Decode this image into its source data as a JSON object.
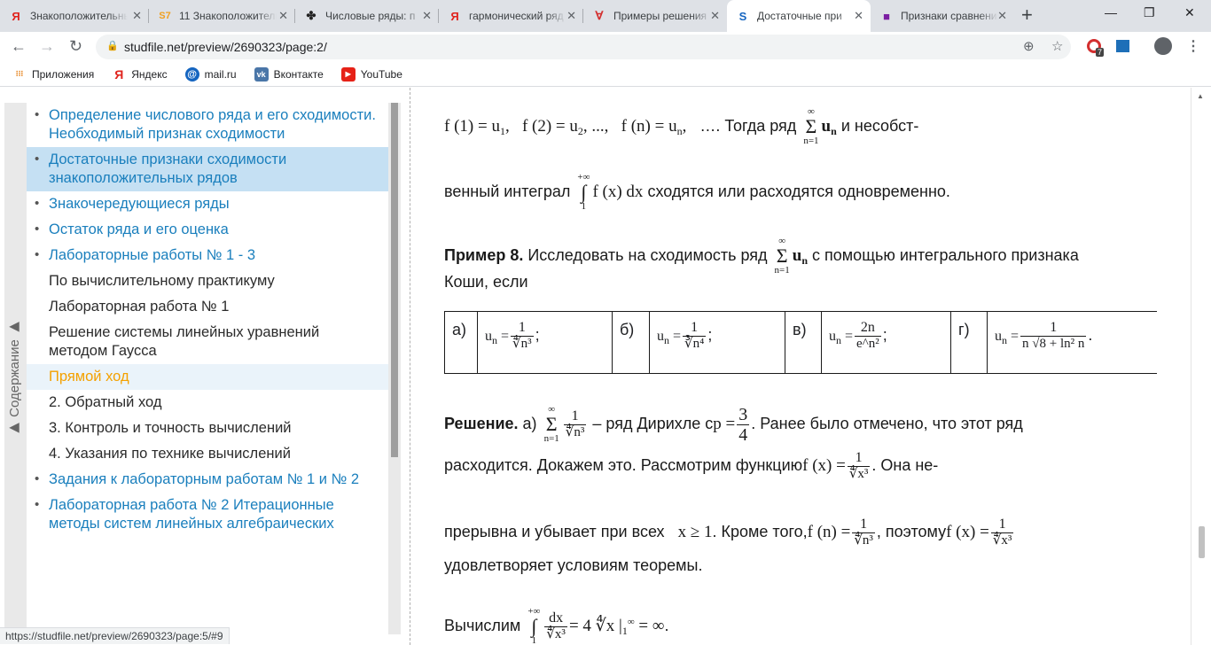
{
  "browser": {
    "tabs": [
      {
        "icon": "Я",
        "title": "Знакоположительные"
      },
      {
        "icon": "S7",
        "title": "11 Знакоположительные"
      },
      {
        "icon": "✤",
        "title": "Числовые ряды: п"
      },
      {
        "icon": "Я",
        "title": "гармонический ряд"
      },
      {
        "icon": "∀",
        "title": "Примеры решения"
      },
      {
        "icon": "S",
        "title": "Достаточные при"
      },
      {
        "icon": "■",
        "title": "Признаки сравнения"
      }
    ],
    "url": "studfile.net/preview/2690323/page:2/",
    "extension_badge": "7",
    "bookmarks": [
      {
        "icon": "⁝⁝⁝",
        "label": "Приложения"
      },
      {
        "icon": "Я",
        "label": "Яндекс"
      },
      {
        "icon": "@",
        "label": "mail.ru"
      },
      {
        "icon": "vk",
        "label": "Вконтакте"
      },
      {
        "icon": "▶",
        "label": "YouTube"
      }
    ],
    "status_url": "https://studfile.net/preview/2690323/page:5/#9"
  },
  "sidebar": {
    "tab_label": "▶ Содержание ▶",
    "items": [
      {
        "label": "Определение числового ряда и его сходимости. Необходимый признак сходимости",
        "dot": true,
        "state": "link"
      },
      {
        "label": "Достаточные признаки сходимости знакоположительных рядов",
        "dot": true,
        "state": "selected"
      },
      {
        "label": "Знакочередующиеся ряды",
        "dot": true,
        "state": "link"
      },
      {
        "label": "Остаток ряда и его оценка",
        "dot": true,
        "state": "link"
      },
      {
        "label": "Лабораторные работы № 1 - 3",
        "dot": true,
        "state": "link"
      },
      {
        "label": "По вычислительному практикуму",
        "dot": false,
        "state": "plain"
      },
      {
        "label": "Лабораторная работа № 1",
        "dot": false,
        "state": "plain"
      },
      {
        "label": "Решение системы линейных уравнений методом Гаусса",
        "dot": false,
        "state": "plain"
      },
      {
        "label": "Прямой ход",
        "dot": false,
        "state": "highlight"
      },
      {
        "label": "2. Обратный ход",
        "dot": false,
        "state": "plain"
      },
      {
        "label": "3. Контроль и точность вычислений",
        "dot": false,
        "state": "plain"
      },
      {
        "label": "4. Указания по технике вычислений",
        "dot": false,
        "state": "plain"
      },
      {
        "label": "Задания к лабораторным работам № 1 и № 2",
        "dot": true,
        "state": "link"
      },
      {
        "label": "Лабораторная работа № 2 Итерационные методы систем линейных алгебраических",
        "dot": true,
        "state": "link"
      }
    ]
  },
  "doc": {
    "l1_mid": "…. Тогда ряд",
    "l1_end": "и несобст-",
    "l2_start": "венный интеграл",
    "l2_end": "сходятся или расходятся одновременно.",
    "ex_title": "Пример 8.",
    "ex_text": "Исследовать на сходимость ряд",
    "ex_text2": "с помощью интегрального признака",
    "ex_text3": "Коши, если",
    "table": [
      {
        "label": "а)",
        "num": "1",
        "den": "∜n³"
      },
      {
        "label": "б)",
        "num": "1",
        "den": "∛n⁴"
      },
      {
        "label": "в)",
        "num": "2n",
        "den": "e^n²"
      },
      {
        "label": "г)",
        "num": "1",
        "den": "n √8 + ln² n"
      }
    ],
    "sol_title": "Решение.",
    "sol_a": "а)",
    "sol_t1": "– ряд Дирихле с",
    "sol_t2": ". Ранее было отмечено, что этот ряд",
    "l6_start": "расходится. Докажем это. Рассмотрим функцию",
    "l6_end": ". Она не-",
    "l7_start": "прерывна и убывает при всех",
    "l7_mid": ". Кроме того,",
    "l7_mid2": ", поэтому",
    "l8": "удовлетворяет условиям теоремы.",
    "l9_start": "Вычислим"
  }
}
